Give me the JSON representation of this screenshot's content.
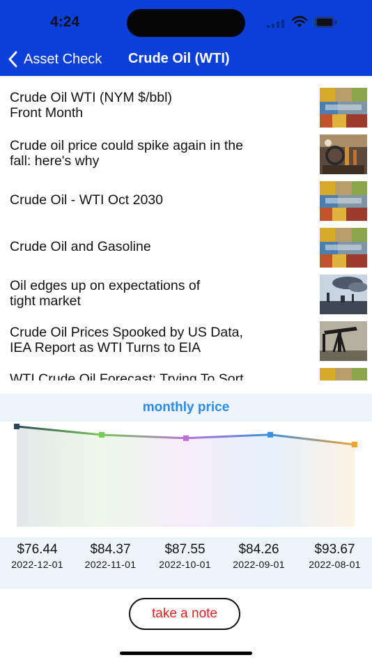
{
  "status_bar": {
    "time": "4:24"
  },
  "nav": {
    "back_label": "Asset Check",
    "title": "Crude Oil (WTI)"
  },
  "news": [
    {
      "title_lines": [
        "Crude Oil WTI (NYM $/bbl)",
        "Front Month"
      ],
      "thumb": "commodities-collage-image"
    },
    {
      "title_lines": [
        "Crude oil price could spike again in the",
        "fall: here's why"
      ],
      "thumb": "refinery-workers-image"
    },
    {
      "title_lines": [
        "Crude Oil - WTI Oct 2030",
        ""
      ],
      "thumb": "commodities-collage-image"
    },
    {
      "title_lines": [
        "Crude Oil and Gasoline",
        ""
      ],
      "thumb": "commodities-collage-image"
    },
    {
      "title_lines": [
        "Oil edges up on expectations of",
        "tight market"
      ],
      "thumb": "refinery-smoke-image"
    },
    {
      "title_lines": [
        "Crude Oil Prices Spooked by US Data,",
        "IEA Report as WTI Turns to EIA"
      ],
      "thumb": "oil-pump-jack-image"
    },
    {
      "title_lines": [
        "WTI Crude Oil Forecast: Trying To Sort",
        ""
      ],
      "thumb": "commodities-collage-image"
    }
  ],
  "chart": {
    "title": "monthly price"
  },
  "chart_data": {
    "type": "line",
    "title": "monthly price",
    "categories": [
      "2022-12-01",
      "2022-11-01",
      "2022-10-01",
      "2022-09-01",
      "2022-08-01"
    ],
    "labels": [
      "$76.44",
      "$84.37",
      "$87.55",
      "$84.26",
      "$93.67"
    ],
    "values": [
      76.44,
      84.37,
      87.55,
      84.26,
      93.67
    ],
    "point_colors": [
      "#2e4758",
      "#79c85a",
      "#b873d8",
      "#3a8fe0",
      "#f0a233"
    ],
    "grid": false
  },
  "actions": {
    "note_label": "take a note"
  }
}
